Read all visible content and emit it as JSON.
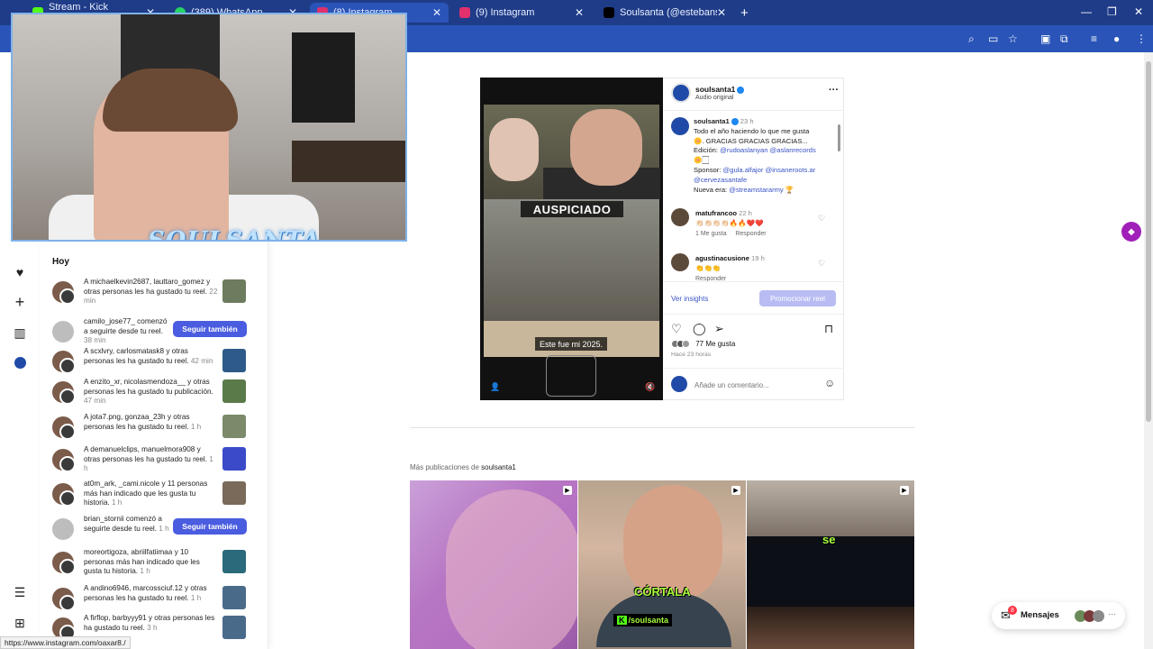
{
  "browser": {
    "tabs": [
      {
        "label": "Stream - Kick Dashboard",
        "color": "#53fc18"
      },
      {
        "label": "(389) WhatsApp",
        "color": "#25d366"
      },
      {
        "label": "(8) Instagram",
        "color": "#e1306c"
      },
      {
        "label": "(9) Instagram",
        "color": "#e1306c"
      },
      {
        "label": "Soulsanta (@estebansantacruz",
        "color": "#000000"
      }
    ],
    "new_tab": "+",
    "window_controls": [
      "—",
      "❐",
      "✕"
    ],
    "status_url": "https://www.instagram.com/oaxar8./"
  },
  "webcam": {
    "overlay_logo": "SOULSANTA"
  },
  "notifications": {
    "section": "Hoy",
    "items": [
      {
        "users": "michaelkevin2687, lauttaro_gomez",
        "prefix": "A ",
        "text": " y otras personas les ha gustado tu reel.",
        "time": "22 min",
        "action": "thumb"
      },
      {
        "users": "camilo_jose77_",
        "prefix": "",
        "text": " comenzó a seguirte desde tu reel.",
        "time": "38 min",
        "action": "follow"
      },
      {
        "users": "scxlvry, carlosmatask8",
        "prefix": "A ",
        "text": " y otras personas les ha gustado tu reel.",
        "time": "42 min",
        "action": "thumb"
      },
      {
        "users": "enzito_xr, nicolasmendoza__",
        "prefix": "A ",
        "text": " y otras personas les ha gustado tu publicación.",
        "time": "47 min",
        "action": "thumb"
      },
      {
        "users": "jota7.png, gonzaa_23h",
        "prefix": "A ",
        "text": " y otras personas les ha gustado tu reel.",
        "time": "1 h",
        "action": "thumb"
      },
      {
        "users": "demanuelclips, manuelmora908",
        "prefix": "A ",
        "text": " y otras personas les ha gustado tu reel.",
        "time": "1 h",
        "action": "thumb"
      },
      {
        "users": "at0m_ark, _cami.nicole",
        "prefix": "",
        "text": " y 11 personas más han indicado que les gusta tu historia.",
        "time": "1 h",
        "action": "thumb"
      },
      {
        "users": "brian_stornii",
        "prefix": "",
        "text": " comenzó a seguirte desde tu reel.",
        "time": "1 h",
        "action": "follow"
      },
      {
        "users": "moreortigoza, abriilfatiimaa",
        "prefix": "",
        "text": " y 10 personas más han indicado que les gusta tu historia.",
        "time": "1 h",
        "action": "thumb"
      },
      {
        "users": "andino6946, marcossciuf.12",
        "prefix": "A ",
        "text": " y otras personas les ha gustado tu reel.",
        "time": "1 h",
        "action": "thumb"
      },
      {
        "users": "firflop, barbyyy91",
        "prefix": "A ",
        "text": " y otras personas les ha gustado tu reel.",
        "time": "3 h",
        "action": "thumb"
      }
    ],
    "follow_label": "Seguir también"
  },
  "post": {
    "video_label": "AUSPICIADO",
    "video_caption": "Este fue mi 2025.",
    "author": "soulsanta1",
    "audio": "Audio original",
    "caption": {
      "user": "soulsanta1",
      "time": "23 h",
      "line1": "Todo el año haciendo lo que me gusta",
      "line2": "🌼. GRACIAS GRACIAS GRACIAS...",
      "edition_label": "Edición: ",
      "edition_links": "@rudoaslanyan @aslanrecords",
      "emoji_line": "🌼🏻",
      "sponsor_label": "Sponsor: ",
      "sponsor_links": "@gula.alfajor @insaneroots.ar @cervezasantafe",
      "new_era_label": "Nueva era: ",
      "new_era_link": "@streamstararmy",
      "trophy": "🏆"
    },
    "comments": [
      {
        "user": "matufrancoo",
        "time": "22 h",
        "text": "👏🏻👏🏻👏🏻👏🏻🔥🔥❤️❤️",
        "meta": "1 Me gusta     Responder"
      },
      {
        "user": "agustinacusione",
        "time": "19 h",
        "text": "👏👏👏",
        "meta": "Responder"
      }
    ],
    "insights": "Ver insights",
    "promote": "Promocionar reel",
    "likes": "77 Me gusta",
    "ago": "Hace 23 horas",
    "comment_placeholder": "Añade un comentario..."
  },
  "more": {
    "label": "Más publicaciones de ",
    "user": "soulsanta1",
    "thumb2_text1": "CÓRTALA",
    "thumb2_text2": "/soulsanta",
    "thumb3_text": "se"
  },
  "messages": {
    "label": "Mensajes",
    "badge": "8"
  }
}
